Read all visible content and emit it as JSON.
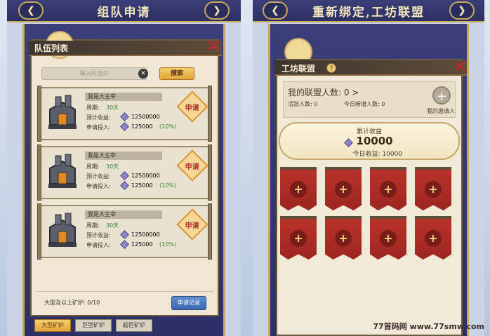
{
  "left": {
    "header_title": "组队申请",
    "window_title": "队伍列表",
    "search_placeholder": "输入队伍ID",
    "search_button": "搜索",
    "teams": [
      {
        "name": "我是大主宰",
        "period_label": "周期:",
        "period_value": "30天",
        "earn_label": "预计收益:",
        "earn_value": "12500000",
        "invest_label": "申请投入:",
        "invest_value": "125000",
        "ratio": "(10%)",
        "apply_label": "申请"
      },
      {
        "name": "我是大主宰",
        "period_label": "周期:",
        "period_value": "30天",
        "earn_label": "预计收益:",
        "earn_value": "12500000",
        "invest_label": "申请投入:",
        "invest_value": "125000",
        "ratio": "(10%)",
        "apply_label": "申请"
      },
      {
        "name": "我是大主宰",
        "period_label": "周期:",
        "period_value": "30天",
        "earn_label": "预计收益:",
        "earn_value": "12500000",
        "invest_label": "申请投入:",
        "invest_value": "125000",
        "ratio": "(10%)",
        "apply_label": "申请"
      }
    ],
    "footer_text": "大型及以上矿炉: 0/10",
    "record_button": "申请记录",
    "tabs": [
      "大型矿炉",
      "巨型矿炉",
      "超巨矿炉"
    ]
  },
  "right": {
    "header_title": "重新绑定,工坊联盟",
    "window_title": "工坊联盟",
    "member_count": "我的联盟人数: 0 >",
    "active_count": "活跃人数: 0",
    "today_new": "今日新增人数: 0",
    "invite_label": "我的邀请人",
    "total_earn_label": "累计收益",
    "total_earn_value": "10000",
    "today_earn": "今日收益: 10000",
    "banner_plus": "+"
  },
  "watermark": "77首码网 www.77smw.com"
}
